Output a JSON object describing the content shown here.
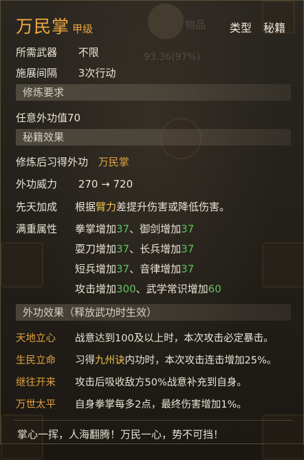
{
  "header": {
    "title": "万民掌",
    "grade": "甲级",
    "type_label": "类型",
    "type_value": "秘籍"
  },
  "background": {
    "tab": "物品",
    "percent": "93.36(97%)"
  },
  "requirements": [
    {
      "label": "所需武器",
      "value": "不限"
    },
    {
      "label": "施展间隔",
      "value": "3次行动"
    }
  ],
  "section_training": "修炼要求",
  "training_req": {
    "label": "任意外功值",
    "value": "70"
  },
  "section_effects": "秘籍效果",
  "learn": {
    "label": "修炼后习得外功",
    "value": "万民掌"
  },
  "power": {
    "label": "外功威力",
    "value": "270 → 720"
  },
  "innate": {
    "label": "先天加成",
    "prefix": "根据",
    "highlight": "臂力",
    "suffix": "差提升伤害或降低伤害。"
  },
  "full_attrs": {
    "label": "满重属性",
    "lines": [
      [
        {
          "name": "拳掌增加",
          "value": "37"
        },
        {
          "name": "、御剑增加",
          "value": "37"
        }
      ],
      [
        {
          "name": "耍刀增加",
          "value": "37"
        },
        {
          "name": "、长兵增加",
          "value": "37"
        }
      ],
      [
        {
          "name": "短兵增加",
          "value": "37"
        },
        {
          "name": "、音律增加",
          "value": "37"
        }
      ],
      [
        {
          "name": "攻击增加",
          "value": "300"
        },
        {
          "name": "、武学常识增加",
          "value": "60"
        }
      ]
    ]
  },
  "section_release": "外功效果（释放武功时生效）",
  "effects": [
    {
      "name": "天地立心",
      "text": "战意达到100及以上时，本次攻击必定暴击。"
    },
    {
      "name": "生民立命",
      "prefix": "习得",
      "highlight": "九州诀",
      "text": "内功时，本次攻击连击增加25%。"
    },
    {
      "name": "继往开来",
      "text": "攻击后吸收敌方50%战意补充到自身。"
    },
    {
      "name": "万世太平",
      "text": "自身拳掌每多2点，最终伤害增加1%。"
    }
  ],
  "footer": "掌心一挥，人海翻腾！万民一心，势不可挡！",
  "colors": {
    "title": "#f0a840",
    "green": "#5ec25e",
    "highlight": "#f0c048",
    "effect_name": "#e0a040"
  }
}
